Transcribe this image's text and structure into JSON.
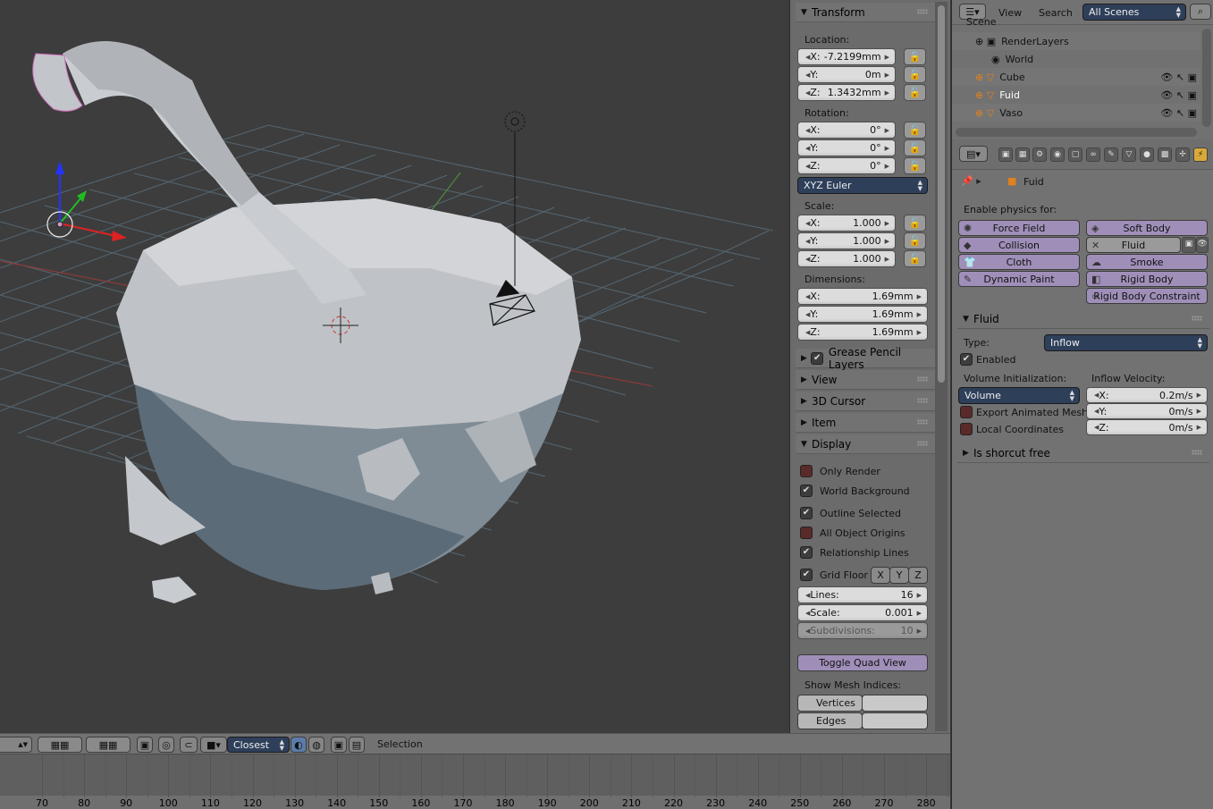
{
  "viewport": {
    "grid_lines": 16,
    "objects": [
      "cube-mesh",
      "fluid-mesh",
      "camera",
      "lamp",
      "3d-cursor",
      "transform-manipulator"
    ]
  },
  "npanel": {
    "transform": {
      "title": "Transform",
      "location_label": "Location:",
      "location": [
        {
          "axis": "X:",
          "value": "-7.2199mm"
        },
        {
          "axis": "Y:",
          "value": "0m"
        },
        {
          "axis": "Z:",
          "value": "1.3432mm"
        }
      ],
      "rotation_label": "Rotation:",
      "rotation": [
        {
          "axis": "X:",
          "value": "0°"
        },
        {
          "axis": "Y:",
          "value": "0°"
        },
        {
          "axis": "Z:",
          "value": "0°"
        }
      ],
      "rotation_mode": "XYZ Euler",
      "scale_label": "Scale:",
      "scale": [
        {
          "axis": "X:",
          "value": "1.000"
        },
        {
          "axis": "Y:",
          "value": "1.000"
        },
        {
          "axis": "Z:",
          "value": "1.000"
        }
      ],
      "dimensions_label": "Dimensions:",
      "dimensions": [
        {
          "axis": "X:",
          "value": "1.69mm"
        },
        {
          "axis": "Y:",
          "value": "1.69mm"
        },
        {
          "axis": "Z:",
          "value": "1.69mm"
        }
      ]
    },
    "collapsed": [
      "Grease Pencil Layers",
      "View",
      "3D Cursor",
      "Item"
    ],
    "display": {
      "title": "Display",
      "options": [
        {
          "label": "Only Render",
          "checked": false
        },
        {
          "label": "World Background",
          "checked": true
        },
        {
          "label": "Outline Selected",
          "checked": true
        },
        {
          "label": "All Object Origins",
          "checked": false
        },
        {
          "label": "Relationship Lines",
          "checked": true
        }
      ],
      "grid_floor": {
        "label": "Grid Floor",
        "checked": true,
        "axes": [
          "X",
          "Y",
          "Z"
        ]
      },
      "lines": {
        "label": "Lines:",
        "value": "16"
      },
      "scale": {
        "label": "Scale:",
        "value": "0.001"
      },
      "subdivisions": {
        "label": "Subdivisions:",
        "value": "10"
      },
      "toggle_quad_view": "Toggle Quad View",
      "mesh_indices_label": "Show Mesh Indices:",
      "vertices": "Vertices",
      "edges": "Edges"
    }
  },
  "outliner": {
    "menu": [
      "View",
      "Search"
    ],
    "scene_filter": "All Scenes",
    "items": [
      {
        "name": "Scene",
        "indent": 0
      },
      {
        "name": "RenderLayers",
        "indent": 1
      },
      {
        "name": "World",
        "indent": 1
      },
      {
        "name": "Cube",
        "indent": 1
      },
      {
        "name": "Fuid",
        "indent": 1
      },
      {
        "name": "Vaso",
        "indent": 1
      }
    ]
  },
  "properties": {
    "object_name": "Fuid",
    "enable_physics_label": "Enable physics for:",
    "physics_buttons": [
      {
        "label": "Force Field",
        "col": 0
      },
      {
        "label": "Soft Body",
        "col": 1
      },
      {
        "label": "Collision",
        "col": 0
      },
      {
        "label": "Fluid",
        "col": 1
      },
      {
        "label": "Cloth",
        "col": 0
      },
      {
        "label": "Smoke",
        "col": 1
      },
      {
        "label": "Dynamic Paint",
        "col": 0
      },
      {
        "label": "Rigid Body",
        "col": 1
      },
      {
        "label": "Rigid Body Constraint",
        "col": 1
      }
    ],
    "fluid": {
      "title": "Fluid",
      "type_label": "Type:",
      "type_value": "Inflow",
      "enabled_label": "Enabled",
      "volume_init_label": "Volume Initialization:",
      "volume_init_value": "Volume",
      "export_animated_mesh": "Export Animated Mesh",
      "local_coordinates": "Local Coordinates",
      "inflow_velocity_label": "Inflow Velocity:",
      "inflow_velocity": [
        {
          "axis": "X:",
          "value": "0.2m/s"
        },
        {
          "axis": "Y:",
          "value": "0m/s"
        },
        {
          "axis": "Z:",
          "value": "0m/s"
        }
      ]
    },
    "is_shortcut_free": "Is shorcut free"
  },
  "toolbar": {
    "pivot_value": "Closest",
    "selection_label": "Selection"
  },
  "timeline": {
    "frames": [
      "70",
      "80",
      "90",
      "100",
      "110",
      "120",
      "130",
      "140",
      "150",
      "160",
      "170",
      "180",
      "190",
      "200",
      "210",
      "220",
      "230",
      "240",
      "250",
      "260",
      "270",
      "280"
    ]
  }
}
